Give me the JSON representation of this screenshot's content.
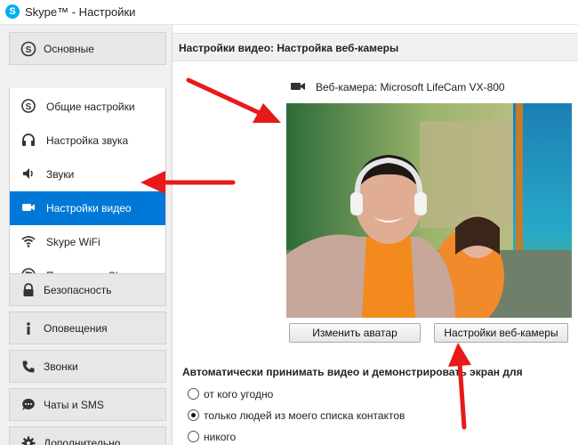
{
  "window": {
    "title": "Skype™ - Настройки",
    "logo_letter": "S"
  },
  "sidebar": {
    "sections_top": [
      {
        "label": "Основные",
        "icon": "skype-icon"
      }
    ],
    "sub_items": [
      {
        "label": "Общие настройки",
        "icon": "skype-icon",
        "active": false
      },
      {
        "label": "Настройка звука",
        "icon": "headset-icon",
        "active": false
      },
      {
        "label": "Звуки",
        "icon": "speaker-icon",
        "active": false
      },
      {
        "label": "Настройки видео",
        "icon": "video-camera-icon",
        "active": true
      },
      {
        "label": "Skype WiFi",
        "icon": "wifi-icon",
        "active": false
      },
      {
        "label": "Переводчик Skype",
        "icon": "globe-icon",
        "active": false
      }
    ],
    "sections_bottom": [
      {
        "label": "Безопасность",
        "icon": "lock-icon"
      },
      {
        "label": "Оповещения",
        "icon": "info-icon"
      },
      {
        "label": "Звонки",
        "icon": "phone-icon"
      },
      {
        "label": "Чаты и SMS",
        "icon": "chat-icon"
      },
      {
        "label": "Дополнительно",
        "icon": "gear-icon"
      }
    ]
  },
  "main": {
    "header_title": "Настройки видео: Настройка веб-камеры",
    "webcam_label": "Веб-камера:  Microsoft LifeCam VX-800",
    "preview_image": "webcam-preview",
    "change_avatar_button": "Изменить аватар",
    "webcam_settings_button": "Настройки веб-камеры",
    "auto_accept_label": "Автоматически принимать видео и демонстрировать экран для",
    "radio_options": [
      {
        "label": "от кого угодно",
        "checked": false
      },
      {
        "label": "только людей из моего списка контактов",
        "checked": true
      },
      {
        "label": "никого",
        "checked": false
      }
    ]
  },
  "annotations": {
    "arrow_color": "#e81919"
  },
  "colors": {
    "accent": "#0078d7",
    "skype_blue": "#00aff0"
  }
}
